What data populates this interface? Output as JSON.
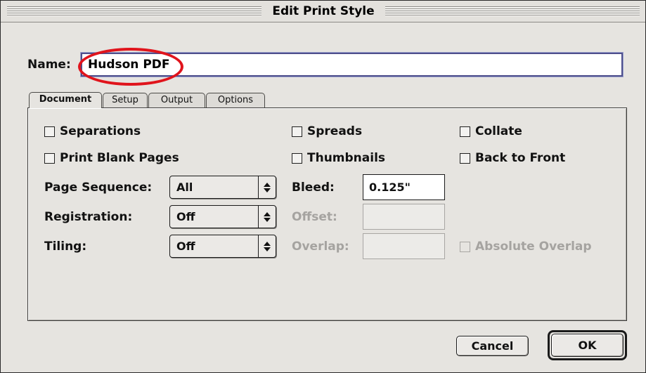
{
  "window": {
    "title": "Edit Print Style"
  },
  "name_field": {
    "label": "Name:",
    "value": "Hudson PDF"
  },
  "tabs": [
    {
      "label": "Document",
      "active": true
    },
    {
      "label": "Setup",
      "active": false
    },
    {
      "label": "Output",
      "active": false
    },
    {
      "label": "Options",
      "active": false
    }
  ],
  "document_tab": {
    "checkboxes": {
      "separations": {
        "label": "Separations",
        "checked": false
      },
      "print_blank_pages": {
        "label": "Print Blank Pages",
        "checked": false
      },
      "spreads": {
        "label": "Spreads",
        "checked": false
      },
      "thumbnails": {
        "label": "Thumbnails",
        "checked": false
      },
      "collate": {
        "label": "Collate",
        "checked": false
      },
      "back_to_front": {
        "label": "Back to Front",
        "checked": false
      },
      "absolute_overlap": {
        "label": "Absolute Overlap",
        "checked": false,
        "enabled": false
      }
    },
    "page_sequence": {
      "label": "Page Sequence:",
      "value": "All"
    },
    "registration": {
      "label": "Registration:",
      "value": "Off"
    },
    "tiling": {
      "label": "Tiling:",
      "value": "Off"
    },
    "bleed": {
      "label": "Bleed:",
      "value": "0.125\""
    },
    "offset": {
      "label": "Offset:",
      "value": "",
      "enabled": false
    },
    "overlap": {
      "label": "Overlap:",
      "value": "",
      "enabled": false
    }
  },
  "buttons": {
    "cancel": "Cancel",
    "ok": "OK"
  },
  "colors": {
    "dialog_background": "#e6e4e0",
    "focus_ring": "#4e4f8c",
    "annotation_oval": "#e0141c",
    "disabled_text": "#a5a3a0"
  }
}
